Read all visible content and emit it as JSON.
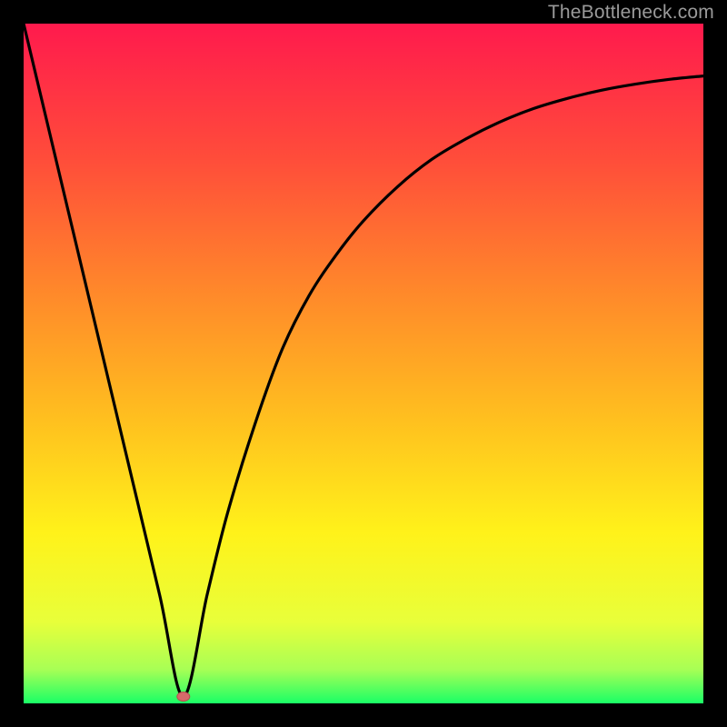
{
  "attribution": "TheBottleneck.com",
  "chart_data": {
    "type": "line",
    "title": "",
    "xlabel": "",
    "ylabel": "",
    "xlim": [
      0,
      100
    ],
    "ylim": [
      0,
      100
    ],
    "grid": false,
    "legend": false,
    "series": [
      {
        "name": "bottleneck-curve",
        "x": [
          0,
          5,
          10,
          15,
          20,
          23.5,
          27,
          30,
          34,
          38,
          42,
          46,
          50,
          55,
          60,
          65,
          70,
          75,
          80,
          85,
          90,
          95,
          100
        ],
        "y": [
          100,
          79,
          58,
          37,
          16,
          1,
          16,
          28,
          41,
          52,
          60,
          66,
          71,
          76,
          80,
          83,
          85.5,
          87.5,
          89,
          90.2,
          91.1,
          91.8,
          92.3
        ]
      }
    ],
    "marker": {
      "name": "minimum-point",
      "x": 23.5,
      "y": 1,
      "color": "#d66a6a"
    },
    "background_gradient_stops": [
      {
        "offset": 0.0,
        "color": "#ff1a4d"
      },
      {
        "offset": 0.2,
        "color": "#ff4d3a"
      },
      {
        "offset": 0.4,
        "color": "#ff8a2a"
      },
      {
        "offset": 0.58,
        "color": "#ffbf1f"
      },
      {
        "offset": 0.75,
        "color": "#fff21a"
      },
      {
        "offset": 0.88,
        "color": "#e8ff3a"
      },
      {
        "offset": 0.95,
        "color": "#a8ff55"
      },
      {
        "offset": 1.0,
        "color": "#1aff66"
      }
    ]
  }
}
